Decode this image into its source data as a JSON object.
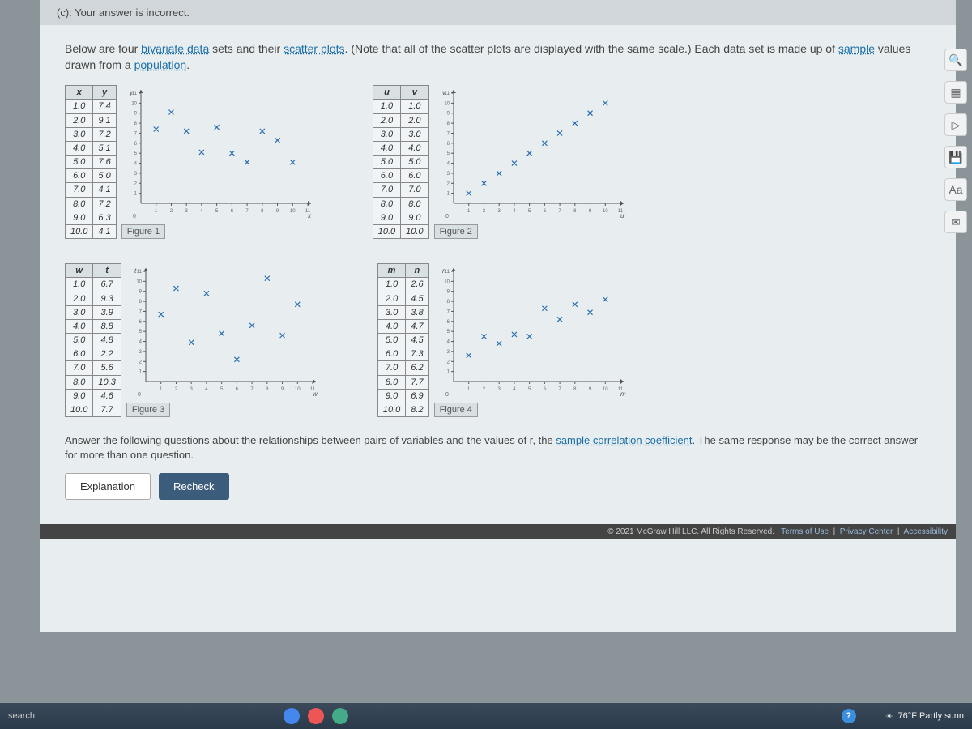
{
  "feedback": "(c): Your answer is incorrect.",
  "intro_pre": "Below are four ",
  "intro_link1": "bivariate data",
  "intro_mid1": " sets and their ",
  "intro_link2": "scatter plots",
  "intro_mid2": ". (Note that all of the scatter plots are displayed with the same scale.) Each data set is made up of ",
  "intro_link3": "sample",
  "intro_mid3": " values drawn from a ",
  "intro_link4": "population",
  "intro_end": ".",
  "question_pre": "Answer the following questions about the relationships between pairs of variables and the values of r, the ",
  "question_link": "sample correlation coefficient",
  "question_post": ". The same response may be the correct answer for more than one question.",
  "btn_explanation": "Explanation",
  "btn_recheck": "Recheck",
  "footer_copyright": "© 2021 McGraw Hill LLC. All Rights Reserved.",
  "footer_terms": "Terms of Use",
  "footer_privacy": "Privacy Center",
  "footer_access": "Accessibility",
  "weather": "76°F Partly sunn",
  "search_label": "search",
  "datasets": [
    {
      "id": 1,
      "col1": "x",
      "col2": "y",
      "ylabel": "y",
      "xaxis": "x",
      "rows": [
        [
          1.0,
          7.4
        ],
        [
          2.0,
          9.1
        ],
        [
          3.0,
          7.2
        ],
        [
          4.0,
          5.1
        ],
        [
          5.0,
          7.6
        ],
        [
          6.0,
          5.0
        ],
        [
          7.0,
          4.1
        ],
        [
          8.0,
          7.2
        ],
        [
          9.0,
          6.3
        ],
        [
          10.0,
          4.1
        ]
      ],
      "figure": "Figure 1"
    },
    {
      "id": 2,
      "col1": "u",
      "col2": "v",
      "ylabel": "v",
      "xaxis": "u",
      "rows": [
        [
          1.0,
          1.0
        ],
        [
          2.0,
          2.0
        ],
        [
          3.0,
          3.0
        ],
        [
          4.0,
          4.0
        ],
        [
          5.0,
          5.0
        ],
        [
          6.0,
          6.0
        ],
        [
          7.0,
          7.0
        ],
        [
          8.0,
          8.0
        ],
        [
          9.0,
          9.0
        ],
        [
          10.0,
          10.0
        ]
      ],
      "figure": "Figure 2"
    },
    {
      "id": 3,
      "col1": "w",
      "col2": "t",
      "ylabel": "t",
      "xaxis": "w",
      "rows": [
        [
          1.0,
          6.7
        ],
        [
          2.0,
          9.3
        ],
        [
          3.0,
          3.9
        ],
        [
          4.0,
          8.8
        ],
        [
          5.0,
          4.8
        ],
        [
          6.0,
          2.2
        ],
        [
          7.0,
          5.6
        ],
        [
          8.0,
          10.3
        ],
        [
          9.0,
          4.6
        ],
        [
          10.0,
          7.7
        ]
      ],
      "figure": "Figure 3"
    },
    {
      "id": 4,
      "col1": "m",
      "col2": "n",
      "ylabel": "n",
      "xaxis": "m",
      "rows": [
        [
          1.0,
          2.6
        ],
        [
          2.0,
          4.5
        ],
        [
          3.0,
          3.8
        ],
        [
          4.0,
          4.7
        ],
        [
          5.0,
          4.5
        ],
        [
          6.0,
          7.3
        ],
        [
          7.0,
          6.2
        ],
        [
          8.0,
          7.7
        ],
        [
          9.0,
          6.9
        ],
        [
          10.0,
          8.2
        ]
      ],
      "figure": "Figure 4"
    }
  ],
  "chart_data": [
    {
      "type": "scatter",
      "title": "Figure 1",
      "xlabel": "x",
      "ylabel": "y",
      "xlim": [
        0,
        11
      ],
      "ylim": [
        0,
        11
      ],
      "x": [
        1,
        2,
        3,
        4,
        5,
        6,
        7,
        8,
        9,
        10
      ],
      "y": [
        7.4,
        9.1,
        7.2,
        5.1,
        7.6,
        5.0,
        4.1,
        7.2,
        6.3,
        4.1
      ]
    },
    {
      "type": "scatter",
      "title": "Figure 2",
      "xlabel": "u",
      "ylabel": "v",
      "xlim": [
        0,
        11
      ],
      "ylim": [
        0,
        11
      ],
      "x": [
        1,
        2,
        3,
        4,
        5,
        6,
        7,
        8,
        9,
        10
      ],
      "y": [
        1,
        2,
        3,
        4,
        5,
        6,
        7,
        8,
        9,
        10
      ]
    },
    {
      "type": "scatter",
      "title": "Figure 3",
      "xlabel": "w",
      "ylabel": "t",
      "xlim": [
        0,
        11
      ],
      "ylim": [
        0,
        11
      ],
      "x": [
        1,
        2,
        3,
        4,
        5,
        6,
        7,
        8,
        9,
        10
      ],
      "y": [
        6.7,
        9.3,
        3.9,
        8.8,
        4.8,
        2.2,
        5.6,
        10.3,
        4.6,
        7.7
      ]
    },
    {
      "type": "scatter",
      "title": "Figure 4",
      "xlabel": "m",
      "ylabel": "n",
      "xlim": [
        0,
        11
      ],
      "ylim": [
        0,
        11
      ],
      "x": [
        1,
        2,
        3,
        4,
        5,
        6,
        7,
        8,
        9,
        10
      ],
      "y": [
        2.6,
        4.5,
        3.8,
        4.7,
        4.5,
        7.3,
        6.2,
        7.7,
        6.9,
        8.2
      ]
    }
  ]
}
